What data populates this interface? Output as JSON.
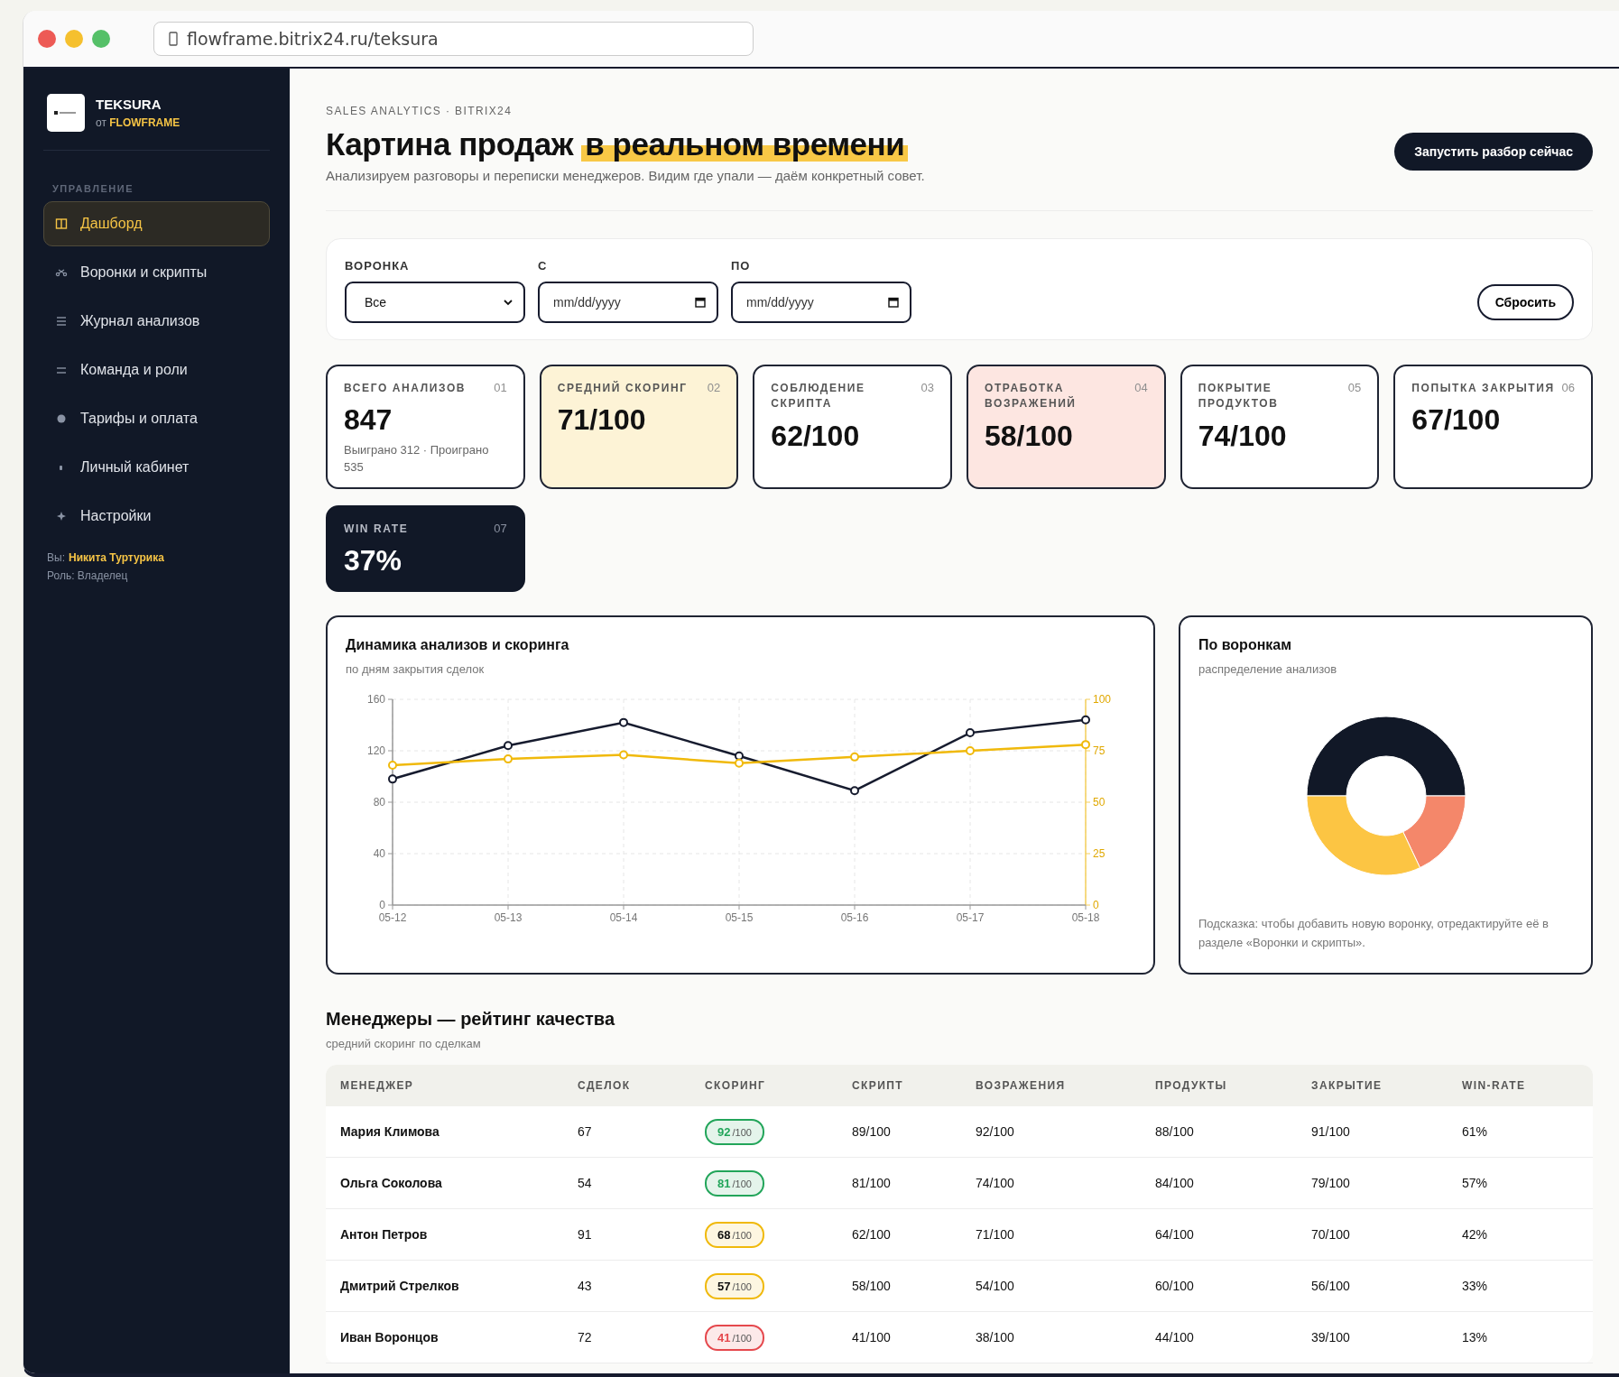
{
  "browser": {
    "url": "flowframe.bitrix24.ru/teksura"
  },
  "sidebar": {
    "brand": "TEKSURA",
    "brand_by": "от",
    "brand_sub": "FLOWFRAME",
    "section": "УПРАВЛЕНИЕ",
    "items": [
      {
        "label": "Дашборд",
        "selected": true
      },
      {
        "label": "Воронки и скрипты",
        "selected": false
      },
      {
        "label": "Журнал анализов",
        "selected": false
      },
      {
        "label": "Команда и роли",
        "selected": false
      },
      {
        "label": "Тарифы и оплата",
        "selected": false
      },
      {
        "label": "Личный кабинет",
        "selected": false
      },
      {
        "label": "Настройки",
        "selected": false
      }
    ],
    "user_label": "Вы:",
    "user_name": "Никита Туртурика",
    "role": "Роль: Владелец"
  },
  "header": {
    "eyebrow": "SALES ANALYTICS · BITRIX24",
    "title": "Картина продаж",
    "title_highlight": "в реальном времени",
    "subtitle": "Анализируем разговоры и переписки менеджеров. Видим где упали — даём конкретный совет.",
    "action": "Запустить разбор сейчас"
  },
  "filters": {
    "funnel_label": "ВОРОНКА",
    "funnel_value": "Все",
    "from_label": "С",
    "from_placeholder": "mm/dd/yyyy",
    "to_label": "ПО",
    "to_placeholder": "mm/dd/yyyy",
    "reset": "Сбросить"
  },
  "kpis": [
    {
      "kind": "plain",
      "label": "ВСЕГО АНАЛИЗОВ",
      "index": "01",
      "value": "847",
      "note": "Выиграно 312 · Проиграно 535"
    },
    {
      "kind": "yellow",
      "label": "СРЕДНИЙ СКОРИНГ",
      "index": "02",
      "value": "71/100"
    },
    {
      "kind": "plain",
      "label": "СОБЛЮДЕНИЕ СКРИПТА",
      "index": "03",
      "value": "62/100"
    },
    {
      "kind": "pink",
      "label": "ОТРАБОТКА ВОЗРАЖЕНИЙ",
      "index": "04",
      "value": "58/100"
    },
    {
      "kind": "plain",
      "label": "ПОКРЫТИЕ ПРОДУКТОВ",
      "index": "05",
      "value": "74/100"
    },
    {
      "kind": "plain",
      "label": "ПОПЫТКА ЗАКРЫТИЯ",
      "index": "06",
      "value": "67/100"
    },
    {
      "kind": "dark",
      "label": "WIN RATE",
      "index": "07",
      "value": "37%"
    }
  ],
  "trend": {
    "title": "Динамика анализов и скоринга",
    "subtitle": "по дням закрытия сделок",
    "chart_data": {
      "type": "line",
      "categories": [
        "05-12",
        "05-13",
        "05-14",
        "05-15",
        "05-16",
        "05-17",
        "05-18"
      ],
      "ylim": [
        0,
        160
      ],
      "yticks": [
        0,
        40,
        80,
        120,
        160
      ],
      "y2lim": [
        0,
        100
      ],
      "y2ticks": [
        0,
        25,
        50,
        75,
        100
      ],
      "grid": true,
      "series": [
        {
          "color": "#161b2e",
          "marker": "circle",
          "values": [
            98,
            124,
            142,
            116,
            89,
            134,
            144
          ]
        },
        {
          "color": "#f0b90b",
          "axis": "y2",
          "marker": "circle",
          "values": [
            68,
            71,
            73,
            69,
            72,
            75,
            78
          ]
        }
      ]
    }
  },
  "funnels": {
    "title": "По воронкам",
    "subtitle": "распределение анализов",
    "hint": "Подсказка: чтобы добавить новую воронку, отредактируйте её в разделе «Воронки и скрипты».",
    "chart_data": {
      "type": "donut",
      "series": [
        {
          "values": [
            50,
            18,
            32
          ]
        }
      ],
      "colors": [
        "#111827",
        "#f4876a",
        "#fcc543"
      ]
    }
  },
  "managers": {
    "title": "Менеджеры — рейтинг качества",
    "subtitle": "средний скоринг по сделкам",
    "columns": [
      "МЕНЕДЖЕР",
      "СДЕЛОК",
      "СКОРИНГ",
      "СКРИПТ",
      "ВОЗРАЖЕНИЯ",
      "ПРОДУКТЫ",
      "ЗАКРЫТИЕ",
      "WIN-RATE"
    ],
    "rows": [
      {
        "name": "Мария Климова",
        "deals": "67",
        "score": "92",
        "score_max": "/100",
        "color": "#22a55a",
        "script": "89/100",
        "objections": "92/100",
        "products": "88/100",
        "closing": "91/100",
        "winrate": "61%"
      },
      {
        "name": "Ольга Соколова",
        "deals": "54",
        "score": "81",
        "score_max": "/100",
        "color": "#22a55a",
        "script": "81/100",
        "objections": "74/100",
        "products": "84/100",
        "closing": "79/100",
        "winrate": "57%"
      },
      {
        "name": "Антон Петров",
        "deals": "91",
        "score": "68",
        "score_max": "/100",
        "color": "#f0b90b",
        "script": "62/100",
        "objections": "71/100",
        "products": "64/100",
        "closing": "70/100",
        "winrate": "42%"
      },
      {
        "name": "Дмитрий Стрелков",
        "deals": "43",
        "score": "57",
        "score_max": "/100",
        "color": "#f0b90b",
        "script": "58/100",
        "objections": "54/100",
        "products": "60/100",
        "closing": "56/100",
        "winrate": "33%"
      },
      {
        "name": "Иван Воронцов",
        "deals": "72",
        "score": "41",
        "score_max": "/100",
        "color": "#e5484d",
        "script": "41/100",
        "objections": "38/100",
        "products": "44/100",
        "closing": "39/100",
        "winrate": "13%"
      }
    ]
  }
}
